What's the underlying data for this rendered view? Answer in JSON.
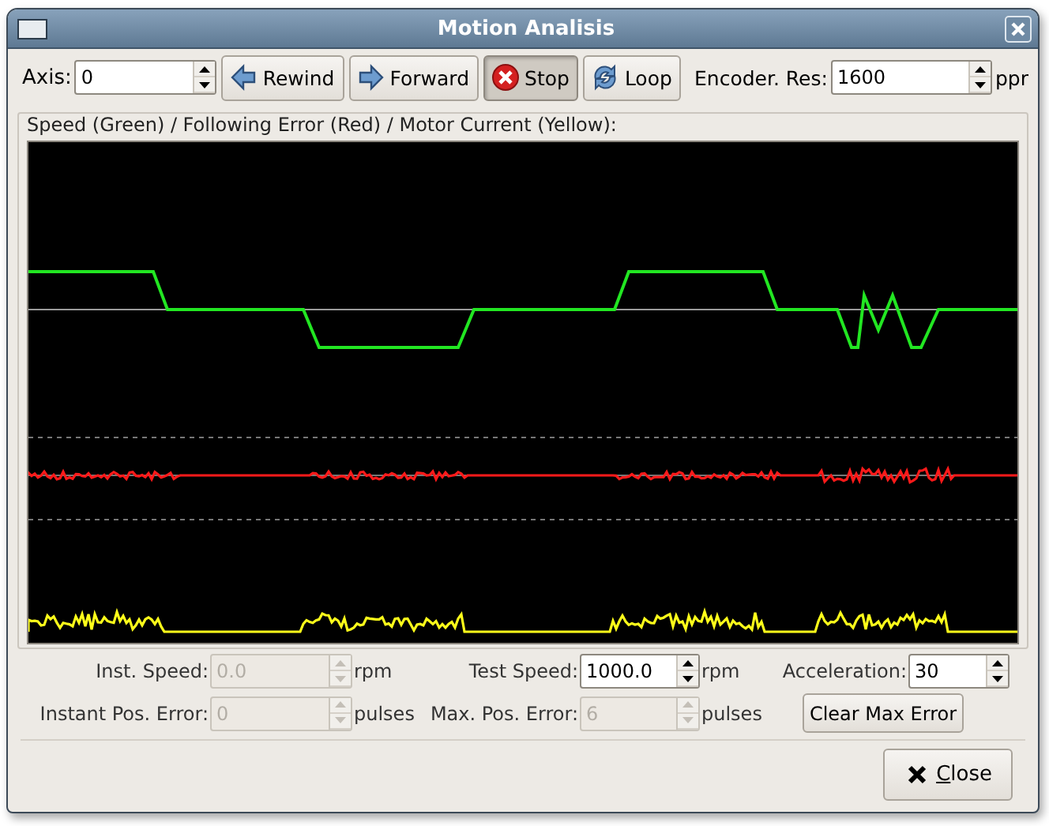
{
  "window": {
    "title": "Motion Analisis"
  },
  "toolbar": {
    "axis": {
      "label": "Axis:",
      "value": "0"
    },
    "buttons": [
      {
        "label": "Rewind",
        "kind": "rewind",
        "pressed": false
      },
      {
        "label": "Forward",
        "kind": "forward",
        "pressed": false
      },
      {
        "label": "Stop",
        "kind": "stop",
        "pressed": true
      },
      {
        "label": "Loop",
        "kind": "loop",
        "pressed": false
      }
    ],
    "encoder": {
      "label": "Encoder. Res:",
      "value": "1600",
      "unit": "ppr"
    }
  },
  "plot": {
    "title": "Speed (Green) / Following Error (Red) / Motor Current (Yellow):"
  },
  "fields": [
    {
      "kind": "spin",
      "label": "Inst. Speed:",
      "value": "0.0",
      "unit": "rpm",
      "disabled": true
    },
    {
      "kind": "spin",
      "label": "Test Speed:",
      "value": "1000.0",
      "unit": "rpm",
      "disabled": false
    },
    {
      "kind": "spin",
      "label": "Acceleration:",
      "value": "30",
      "disabled": false
    },
    {
      "kind": "spin",
      "label": "Instant Pos. Error:",
      "value": "0",
      "unit": "pulses",
      "disabled": true
    },
    {
      "kind": "spin",
      "label": "Max. Pos. Error:",
      "value": "6",
      "unit": "pulses",
      "disabled": true
    },
    {
      "kind": "button",
      "label": "Clear Max Error"
    }
  ],
  "footer": {
    "close_button": "Close"
  }
}
